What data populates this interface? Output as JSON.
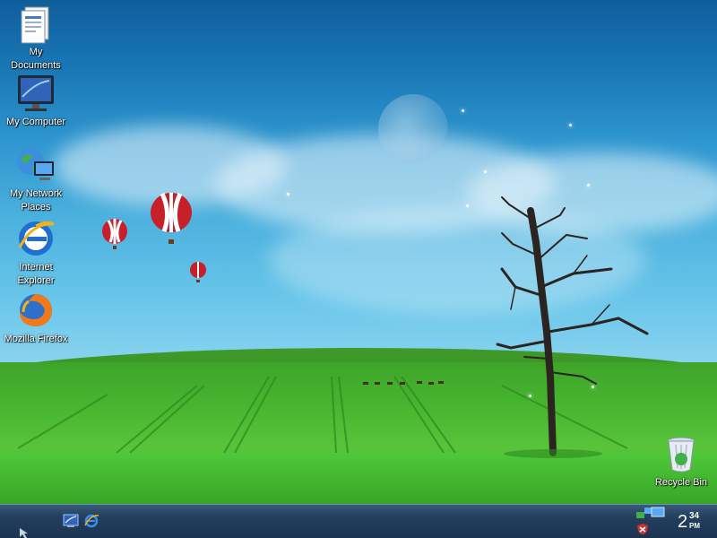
{
  "desktop": {
    "icons": [
      {
        "label": "My Documents",
        "icon": "my-documents-icon"
      },
      {
        "label": "My Computer",
        "icon": "my-computer-icon"
      },
      {
        "label": "My Network Places",
        "icon": "network-places-icon"
      },
      {
        "label": "Internet Explorer",
        "icon": "internet-explorer-icon"
      },
      {
        "label": "Mozilla Firefox",
        "icon": "firefox-icon"
      },
      {
        "label": "Recycle Bin",
        "icon": "recycle-bin-icon"
      }
    ]
  },
  "taskbar": {
    "quick_launch": [
      "show-desktop-icon",
      "internet-explorer-icon"
    ],
    "tray_icons": [
      "network-icon",
      "security-shield-icon"
    ],
    "clock": {
      "hour": "2",
      "minute": "34",
      "ampm": "PM"
    }
  },
  "colors": {
    "sky_top": "#0f5e9c",
    "grass": "#47b52f",
    "taskbar": "#23405e"
  }
}
